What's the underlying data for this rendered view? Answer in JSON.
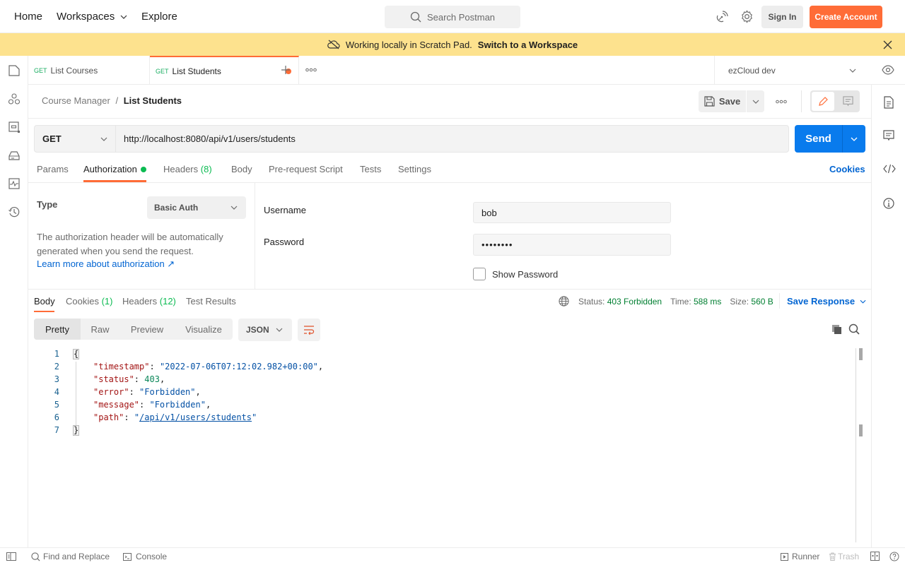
{
  "topbar": {
    "nav": [
      "Home",
      "Workspaces",
      "Explore"
    ],
    "search_placeholder": "Search Postman",
    "sign_in": "Sign In",
    "create_account": "Create Account"
  },
  "banner": {
    "text": "Working locally in Scratch Pad.",
    "link": "Switch to a Workspace"
  },
  "tabs": [
    {
      "method": "GET",
      "name": "List Courses"
    },
    {
      "method": "GET",
      "name": "List Students",
      "unsaved": true
    }
  ],
  "environment": "ezCloud dev",
  "breadcrumb": {
    "parent": "Course Manager",
    "current": "List Students"
  },
  "toolbar": {
    "save": "Save"
  },
  "request": {
    "method": "GET",
    "url": "http://localhost:8080/api/v1/users/students",
    "send": "Send"
  },
  "request_tabs": {
    "params": "Params",
    "authorization": "Authorization",
    "headers": "Headers",
    "headers_count": "(8)",
    "body": "Body",
    "prerequest": "Pre-request Script",
    "tests": "Tests",
    "settings": "Settings",
    "cookies": "Cookies"
  },
  "auth": {
    "type_label": "Type",
    "type_value": "Basic Auth",
    "description": "The authorization header will be automatically generated when you send the request.",
    "learn_more": "Learn more about authorization ↗",
    "username_label": "Username",
    "username_value": "bob",
    "password_label": "Password",
    "password_value": "••••••••",
    "show_password": "Show Password"
  },
  "response_tabs": {
    "body": "Body",
    "cookies": "Cookies",
    "cookies_count": "(1)",
    "headers": "Headers",
    "headers_count": "(12)",
    "test_results": "Test Results"
  },
  "response_meta": {
    "status_label": "Status:",
    "status_value": "403 Forbidden",
    "time_label": "Time:",
    "time_value": "588 ms",
    "size_label": "Size:",
    "size_value": "560 B",
    "save_response": "Save Response"
  },
  "view_modes": [
    "Pretty",
    "Raw",
    "Preview",
    "Visualize"
  ],
  "format": "JSON",
  "response_body": {
    "lines": [
      "1",
      "2",
      "3",
      "4",
      "5",
      "6",
      "7"
    ],
    "timestamp_key": "\"timestamp\"",
    "timestamp_val": "\"2022-07-06T07:12:02.982+00:00\"",
    "status_key": "\"status\"",
    "status_val": "403",
    "error_key": "\"error\"",
    "error_val": "\"Forbidden\"",
    "message_key": "\"message\"",
    "message_val": "\"Forbidden\"",
    "path_key": "\"path\"",
    "path_val": "/api/v1/users/students"
  },
  "statusbar": {
    "find_replace": "Find and Replace",
    "console": "Console",
    "runner": "Runner",
    "trash": "Trash"
  },
  "colors": {
    "accent": "#ff6c37",
    "primary": "#097bed",
    "banner": "#fde28e",
    "success": "#0cbb52"
  }
}
